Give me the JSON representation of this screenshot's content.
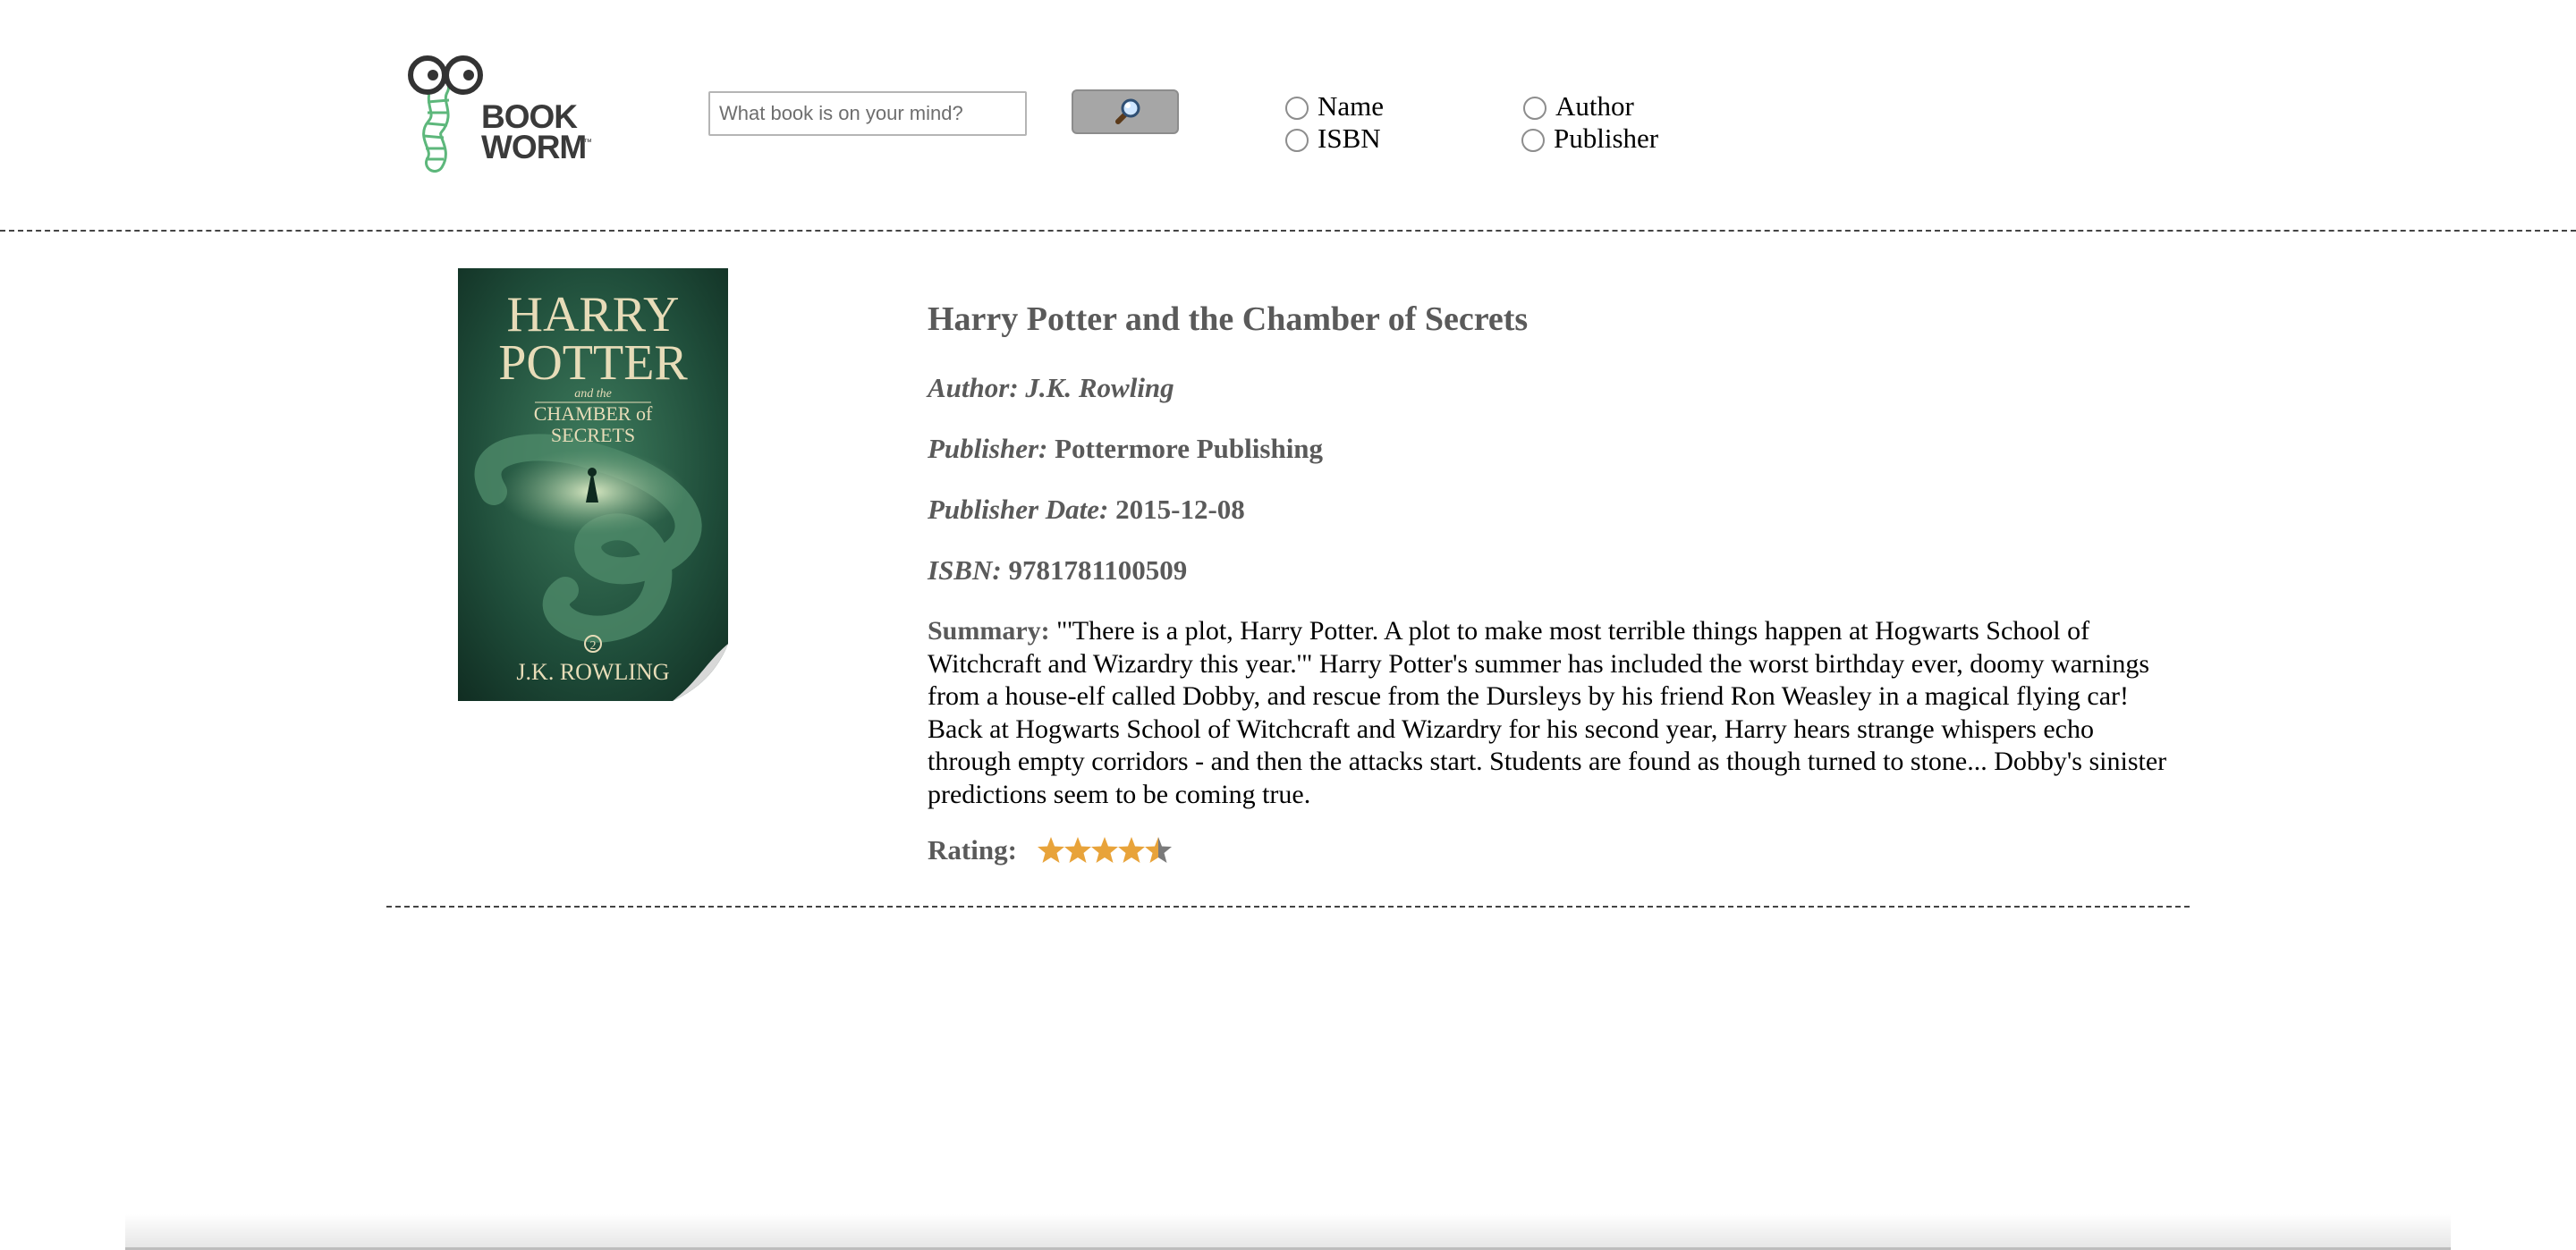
{
  "header": {
    "logo": {
      "text": "BOOK\nWORM",
      "trademark": "™",
      "colors": {
        "worm": "#5db77b",
        "glasses": "#333333",
        "text": "#3a3a3a"
      }
    },
    "search": {
      "placeholder": "What book is on your mind?",
      "value": "",
      "button_icon": "magnifier-icon"
    },
    "search_by": {
      "options": [
        {
          "label": "Name",
          "checked": false
        },
        {
          "label": "Author",
          "checked": false
        },
        {
          "label": "ISBN",
          "checked": false
        },
        {
          "label": "Publisher",
          "checked": false
        }
      ]
    }
  },
  "book": {
    "cover": {
      "title_line1": "HARRY",
      "title_line2": "POTTER",
      "subtitle_small": "and the",
      "subtitle_line1": "CHAMBER of",
      "subtitle_line2": "SECRETS",
      "volume": "2",
      "author": "J.K. ROWLING"
    },
    "title": "Harry Potter and the Chamber of Secrets",
    "author_label": "Author:",
    "author": "J.K. Rowling",
    "publisher_label": "Publisher:",
    "publisher": "Pottermore Publishing",
    "publisher_date_label": "Publisher Date:",
    "publisher_date": "2015-12-08",
    "isbn_label": "ISBN:",
    "isbn": "9781781100509",
    "summary_label": "Summary:",
    "summary": "\"'There is a plot, Harry Potter. A plot to make most terrible things happen at Hogwarts School of Witchcraft and Wizardry this year.'\" Harry Potter's summer has included the worst birthday ever, doomy warnings from a house-elf called Dobby, and rescue from the Dursleys by his friend Ron Weasley in a magical flying car! Back at Hogwarts School of Witchcraft and Wizardry for his second year, Harry hears strange whispers echo through empty corridors - and then the attacks start. Students are found as though turned to stone... Dobby's sinister predictions seem to be coming true.",
    "rating_label": "Rating:",
    "rating": 4.5,
    "rating_max": 5,
    "colors": {
      "star_filled": "#e8a33a",
      "star_empty": "#7a7a7a"
    }
  }
}
